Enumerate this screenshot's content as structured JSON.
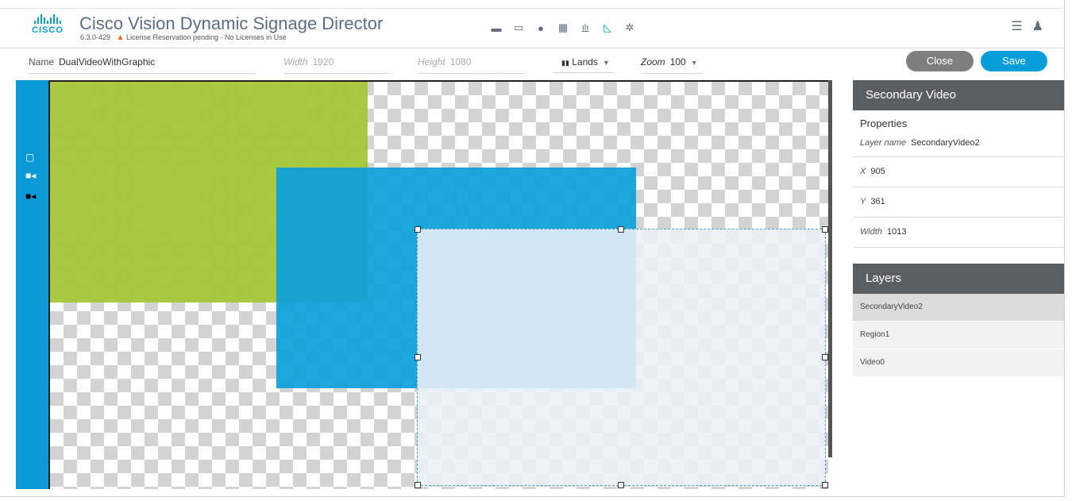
{
  "app": {
    "logo_text": "CISCO",
    "title": "Cisco Vision Dynamic Signage Director",
    "version": "6.3.0-429",
    "license_warning": "License Reservation pending - No Licenses in Use"
  },
  "top_icons": [
    "folder-icon",
    "monitor-icon",
    "play-icon",
    "calendar-icon",
    "bar-chart-icon",
    "design-triangle-icon",
    "gear-icon"
  ],
  "toolbar": {
    "name_label": "Name",
    "name_value": "DualVideoWithGraphic",
    "width_label": "Width",
    "width_value": "1920",
    "height_label": "Height",
    "height_value": "1080",
    "orientation_value": "Lands",
    "zoom_label": "Zoom",
    "zoom_value": "100",
    "close_label": "Close",
    "save_label": "Save"
  },
  "panel": {
    "title": "Secondary Video",
    "properties_label": "Properties",
    "layer_name_label": "Layer name",
    "layer_name_value": "SecondaryVideo2",
    "x_label": "X",
    "x_value": "905",
    "y_label": "Y",
    "y_value": "361",
    "width_label": "Width",
    "width_value": "1013"
  },
  "layers": {
    "title": "Layers",
    "items": [
      {
        "label": "SecondaryVideo2"
      },
      {
        "label": "Region1"
      },
      {
        "label": "Video0"
      }
    ]
  },
  "colors": {
    "accent": "#049fd9",
    "region_green": "#a4c639",
    "video_blue": "#0da0da",
    "panel_header": "#595e63"
  }
}
